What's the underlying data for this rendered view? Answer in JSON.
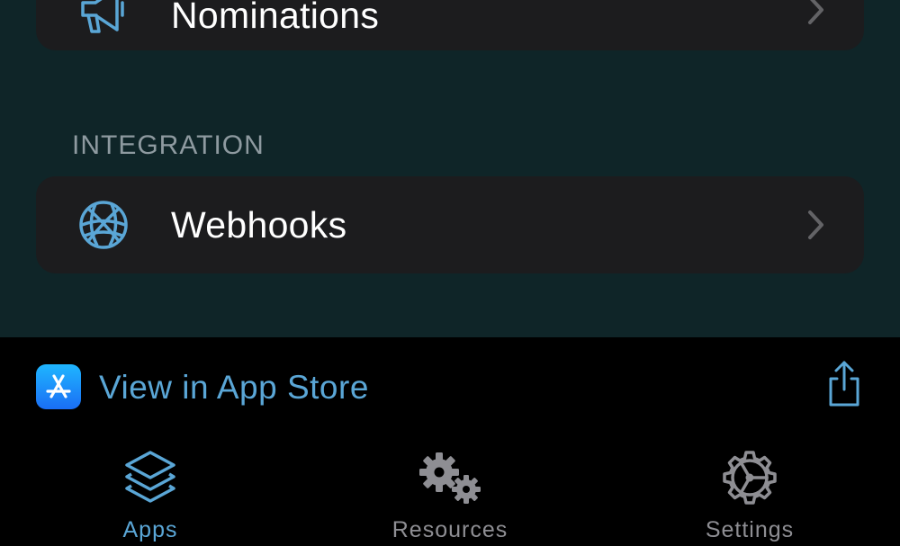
{
  "list": {
    "top_row": {
      "label": "Nominations",
      "icon": "megaphone-icon"
    },
    "section_header": "INTEGRATION",
    "webhooks_row": {
      "label": "Webhooks",
      "icon": "globe-icon"
    }
  },
  "app_store_banner": {
    "label": "View in App Store",
    "icon": "app-store-icon",
    "share_icon": "share-icon"
  },
  "tabbar": {
    "tabs": [
      {
        "label": "Apps",
        "icon": "layers-icon",
        "active": true
      },
      {
        "label": "Resources",
        "icon": "gears-icon",
        "active": false
      },
      {
        "label": "Settings",
        "icon": "gear-icon",
        "active": false
      }
    ]
  },
  "colors": {
    "background": "#0f2528",
    "card": "#1c1c1e",
    "accent": "#5aa6d6",
    "inactive": "#8e8e93",
    "section_header": "#8e9aa0"
  }
}
